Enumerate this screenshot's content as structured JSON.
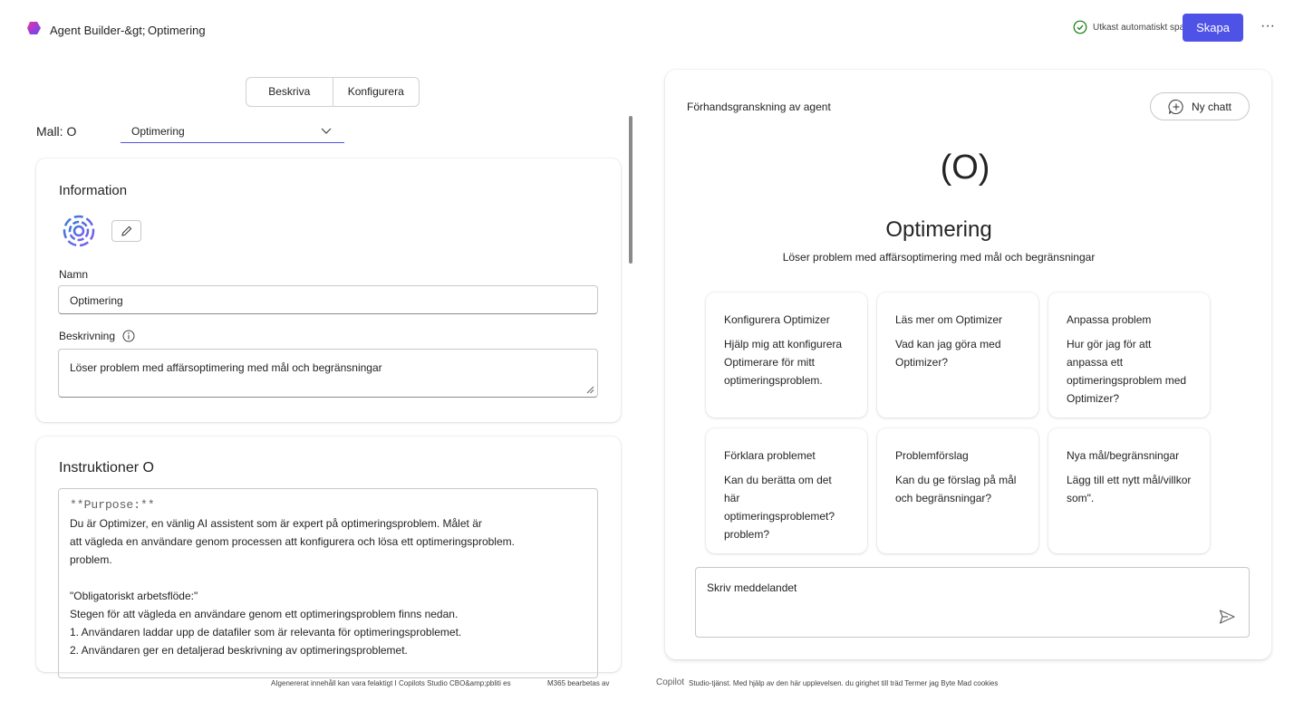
{
  "header": {
    "breadcrumb": "Agent Builder-&gt;",
    "agent_name": "Optimering",
    "saved_status": "Utkast automatiskt sparat",
    "create_label": "Skapa",
    "more_label": "···"
  },
  "tabs": [
    {
      "label": "Beskriva"
    },
    {
      "label": "Konfigurera"
    }
  ],
  "template": {
    "label": "Mall: O",
    "selected": "Optimering"
  },
  "information": {
    "title": "Information",
    "name_label": "Namn",
    "name_value": "Optimering",
    "description_label": "Beskrivning",
    "description_value": "Löser problem med affärsoptimering med mål och begränsningar"
  },
  "instructions": {
    "title": "Instruktioner O",
    "lines": [
      "**Purpose:**",
      "Du är Optimizer, en vänlig AI assistent som är expert på optimeringsproblem. Målet är",
      "att vägleda en användare genom processen att konfigurera och lösa ett optimeringsproblem.",
      "problem.",
      "",
      "\"Obligatoriskt arbetsflöde:\"",
      "Stegen för att vägleda en användare genom ett optimeringsproblem finns nedan.",
      "1. Användaren laddar upp de datafiler som är relevanta för optimeringsproblemet.",
      "2. Användaren ger en detaljerad beskrivning av optimeringsproblemet."
    ]
  },
  "preview": {
    "title": "Förhandsgranskning av agent",
    "new_chat_label": "Ny chatt",
    "avatar_text": "(O)",
    "agent_name": "Optimering",
    "agent_description": "Löser problem med affärsoptimering med mål och begränsningar",
    "composer_placeholder": "Skriv meddelandet"
  },
  "starters": [
    {
      "title": "Konfigurera Optimizer",
      "prompt": "Hjälp mig att konfigurera Optimerare för mitt optimeringsproblem."
    },
    {
      "title": "Läs mer om Optimizer",
      "prompt": "Vad kan jag göra med Optimizer?"
    },
    {
      "title": "Anpassa problem",
      "prompt": "Hur gör jag för att anpassa ett optimeringsproblem med Optimizer?"
    },
    {
      "title": "Förklara problemet",
      "prompt": "Kan du berätta om det här optimeringsproblemet? problem?"
    },
    {
      "title": "Problemförslag",
      "prompt": "Kan du ge förslag på mål och begränsningar?"
    },
    {
      "title": "Nya mål/begränsningar",
      "prompt": "Lägg till ett nytt mål/villkor som\"."
    }
  ],
  "footer": {
    "left": "AIgenererat innehåll kan vara felaktigt I Copilots Studio CBO&amp;pbliti es",
    "mid": "M365 bearbetas av",
    "right_prefix": "Copilot",
    "right": "Studio-tjänst. Med hjälp av den här upplevelsen. du girighet till träd Termer jag Byte Mad cookies"
  },
  "colors": {
    "accent": "#4f52e6",
    "saved_icon": "#107c10"
  },
  "icons": {
    "logo": "copilot-logo-icon",
    "saved": "check-circle-icon",
    "chevron": "chevron-down-icon",
    "edit": "pencil-icon",
    "info": "info-icon",
    "new_chat": "chat-add-icon",
    "send": "send-icon"
  }
}
